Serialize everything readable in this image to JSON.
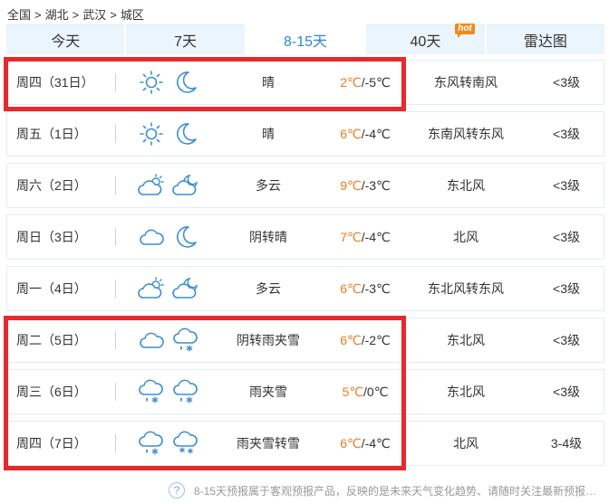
{
  "breadcrumb": [
    "全国",
    "湖北",
    "武汉",
    "城区"
  ],
  "tabs": [
    {
      "label": "今天",
      "active": false
    },
    {
      "label": "7天",
      "active": false
    },
    {
      "label": "8-15天",
      "active": true
    },
    {
      "label": "40天",
      "active": false,
      "badge": "hot"
    },
    {
      "label": "雷达图",
      "active": false
    }
  ],
  "forecast": [
    {
      "day": "周四（31日）",
      "icons": [
        "sunny-icon",
        "moon-icon"
      ],
      "desc": "晴",
      "hi": "2℃",
      "lo": "/-5℃",
      "wind": "东风转南风",
      "level": "<3级"
    },
    {
      "day": "周五（1日）",
      "icons": [
        "sunny-icon",
        "moon-icon"
      ],
      "desc": "晴",
      "hi": "6℃",
      "lo": "/-4℃",
      "wind": "东南风转东风",
      "level": "<3级"
    },
    {
      "day": "周六（2日）",
      "icons": [
        "partly-cloudy-day-icon",
        "partly-cloudy-night-icon"
      ],
      "desc": "多云",
      "hi": "9℃",
      "lo": "/-3℃",
      "wind": "东北风",
      "level": "<3级"
    },
    {
      "day": "周日（3日）",
      "icons": [
        "cloudy-icon",
        "moon-icon"
      ],
      "desc": "阴转晴",
      "hi": "7℃",
      "lo": "/-4℃",
      "wind": "北风",
      "level": "<3级"
    },
    {
      "day": "周一（4日）",
      "icons": [
        "partly-cloudy-day-icon",
        "partly-cloudy-night-icon"
      ],
      "desc": "多云",
      "hi": "6℃",
      "lo": "/-3℃",
      "wind": "东北风转东风",
      "level": "<3级"
    },
    {
      "day": "周二（5日）",
      "icons": [
        "cloudy-icon",
        "sleet-icon"
      ],
      "desc": "阴转雨夹雪",
      "hi": "6℃",
      "lo": "/-2℃",
      "wind": "东北风",
      "level": "<3级"
    },
    {
      "day": "周三（6日）",
      "icons": [
        "sleet-icon",
        "sleet-icon"
      ],
      "desc": "雨夹雪",
      "hi": "5℃",
      "lo": "/0℃",
      "wind": "东北风",
      "level": "<3级"
    },
    {
      "day": "周四（7日）",
      "icons": [
        "sleet-icon",
        "snow-icon"
      ],
      "desc": "雨夹雪转雪",
      "hi": "6℃",
      "lo": "/-4℃",
      "wind": "北风",
      "level": "3-4级"
    }
  ],
  "footer": {
    "text": "8-15天预报属于客观预报产品，反映的是未来天气变化趋势、请随时关注最新预报…"
  },
  "colors": {
    "accent": "#2e86d4",
    "temp_high": "#f07b1d",
    "highlight": "#e8282d",
    "icon_stroke": "#3c8fd3"
  }
}
